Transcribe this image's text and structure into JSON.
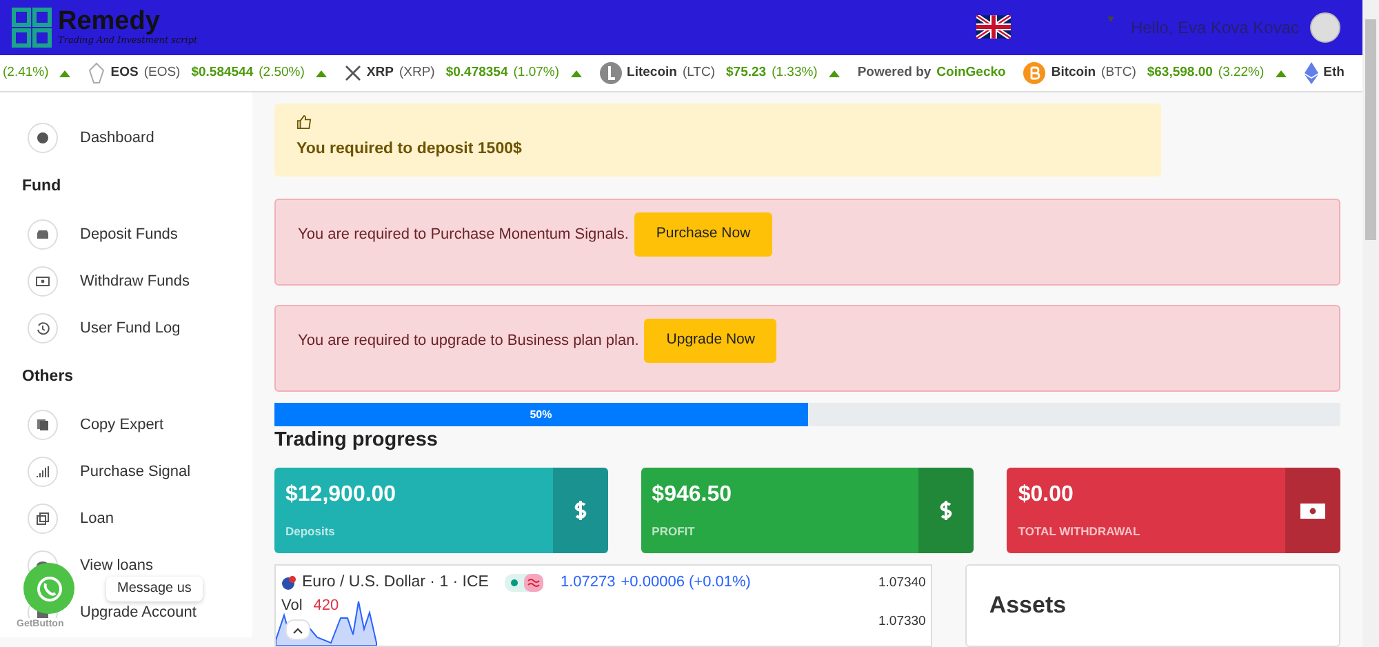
{
  "header": {
    "brand": "Remedy",
    "tagline": "Trading And Investment script",
    "greeting": "Hello, Eva Kova Kovac"
  },
  "ticker": [
    {
      "change": "(2.41%)"
    },
    {
      "name": "EOS",
      "symbol": "(EOS)",
      "price": "$0.584544",
      "change": "(2.50%)"
    },
    {
      "name": "XRP",
      "symbol": "(XRP)",
      "price": "$0.478354",
      "change": "(1.07%)"
    },
    {
      "name": "Litecoin",
      "symbol": "(LTC)",
      "price": "$75.23",
      "change": "(1.33%)"
    },
    {
      "kind": "credit",
      "text": "Powered by",
      "link": "CoinGecko"
    },
    {
      "name": "Bitcoin",
      "symbol": "(BTC)",
      "price": "$63,598.00",
      "change": "(3.22%)"
    },
    {
      "name": "Eth"
    }
  ],
  "sidebar": [
    {
      "kind": "item",
      "label": "Dashboard"
    },
    {
      "kind": "heading",
      "label": "Fund"
    },
    {
      "kind": "item",
      "label": "Deposit Funds"
    },
    {
      "kind": "item",
      "label": "Withdraw Funds"
    },
    {
      "kind": "item",
      "label": "User Fund Log"
    },
    {
      "kind": "heading",
      "label": "Others"
    },
    {
      "kind": "item",
      "label": "Copy Expert"
    },
    {
      "kind": "item",
      "label": "Purchase Signal"
    },
    {
      "kind": "item",
      "label": "Loan"
    },
    {
      "kind": "item",
      "label": "View loans"
    },
    {
      "kind": "item",
      "label": "Upgrade Account"
    }
  ],
  "chat_widget": {
    "tooltip": "Message us",
    "brand": "GetButton"
  },
  "alerts": [
    {
      "kind": "warning",
      "text": "You required to deposit 1500$"
    },
    {
      "kind": "danger",
      "text": "You are required to Purchase Monentum Signals.",
      "button": "Purchase Now"
    },
    {
      "kind": "danger",
      "text": "You are required to upgrade to Business plan plan.",
      "button": "Upgrade Now"
    }
  ],
  "progress": {
    "level": 0.5,
    "label": "50%"
  },
  "section_title": "Trading progress",
  "stats": [
    {
      "value": "$12,900.00",
      "label": "Deposits",
      "color": "#20b2b0"
    },
    {
      "value": "$946.50",
      "label": "PROFIT",
      "color": "#28a745"
    },
    {
      "value": "$0.00",
      "label": "TOTAL WITHDRAWAL",
      "color": "#dc3545"
    }
  ],
  "chart": {
    "symbol": "Euro / U.S. Dollar · 1 · ICE",
    "price": "1.07273",
    "change": "+0.00006 (+0.01%)",
    "volume_label": "Vol",
    "volume": "420",
    "axis": [
      "1.07340",
      "1.07330"
    ]
  },
  "assets": {
    "title": "Assets"
  }
}
